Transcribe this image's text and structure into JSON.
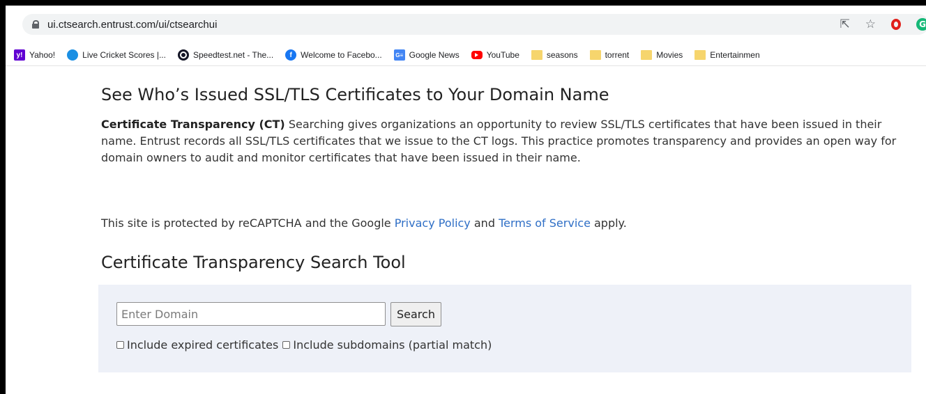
{
  "browser": {
    "url": "ui.ctsearch.entrust.com/ui/ctsearchui",
    "ext_label": "G"
  },
  "bookmarks": [
    {
      "label": "Yahoo!",
      "icon": "yahoo-icon",
      "glyph": "y!"
    },
    {
      "label": "Live Cricket Scores |...",
      "icon": "cricket-icon",
      "glyph": ""
    },
    {
      "label": "Speedtest.net - The...",
      "icon": "speedtest-icon",
      "glyph": ""
    },
    {
      "label": "Welcome to Facebo...",
      "icon": "facebook-icon",
      "glyph": "f"
    },
    {
      "label": "Google News",
      "icon": "google-news-icon",
      "glyph": "G≡"
    },
    {
      "label": "YouTube",
      "icon": "youtube-icon",
      "glyph": ""
    },
    {
      "label": "seasons",
      "icon": "folder-icon",
      "glyph": ""
    },
    {
      "label": "torrent",
      "icon": "folder-icon",
      "glyph": ""
    },
    {
      "label": "Movies",
      "icon": "folder-icon",
      "glyph": ""
    },
    {
      "label": "Entertainmen",
      "icon": "folder-icon",
      "glyph": ""
    }
  ],
  "page": {
    "title": "See Who’s Issued SSL/TLS Certificates to Your Domain Name",
    "intro_bold": "Certificate Transparency (CT)",
    "intro_text": " Searching gives organizations an opportunity to review SSL/TLS certificates that have been issued in their name. Entrust records all SSL/TLS certificates that we issue to the CT logs. This practice promotes transparency and provides an open way for domain owners to audit and monitor certificates that have been issued in their name.",
    "recaptcha_prefix": "This site is protected by reCAPTCHA and the Google ",
    "privacy_link": "Privacy Policy",
    "recaptcha_and": " and ",
    "terms_link": "Terms of Service",
    "recaptcha_suffix": " apply.",
    "tool_title": "Certificate Transparency Search Tool"
  },
  "search": {
    "placeholder": "Enter Domain",
    "value": "",
    "button": "Search",
    "expired_label": "Include expired certificates",
    "subdomains_label": "Include subdomains (partial match)"
  },
  "colors": {
    "link": "#2f6fc6",
    "panel": "#eef1f8"
  }
}
